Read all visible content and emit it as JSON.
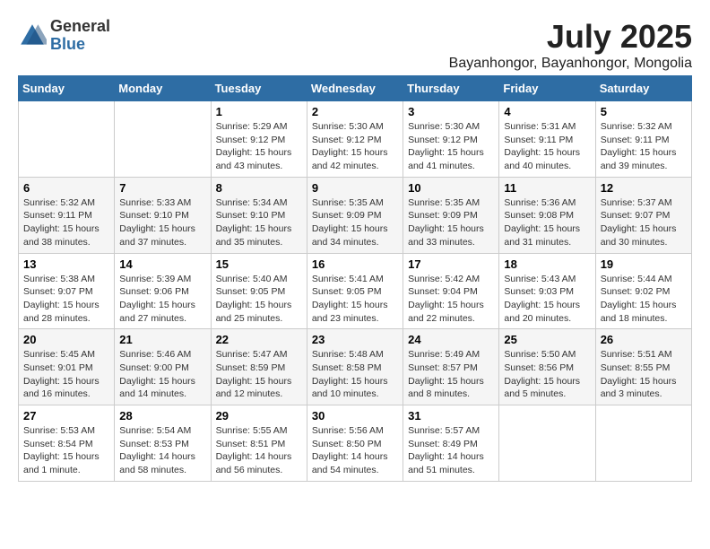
{
  "header": {
    "logo_general": "General",
    "logo_blue": "Blue",
    "month": "July 2025",
    "location": "Bayanhongor, Bayanhongor, Mongolia"
  },
  "calendar": {
    "days_of_week": [
      "Sunday",
      "Monday",
      "Tuesday",
      "Wednesday",
      "Thursday",
      "Friday",
      "Saturday"
    ],
    "weeks": [
      [
        {
          "day": "",
          "sunrise": "",
          "sunset": "",
          "daylight": ""
        },
        {
          "day": "",
          "sunrise": "",
          "sunset": "",
          "daylight": ""
        },
        {
          "day": "1",
          "sunrise": "Sunrise: 5:29 AM",
          "sunset": "Sunset: 9:12 PM",
          "daylight": "Daylight: 15 hours and 43 minutes."
        },
        {
          "day": "2",
          "sunrise": "Sunrise: 5:30 AM",
          "sunset": "Sunset: 9:12 PM",
          "daylight": "Daylight: 15 hours and 42 minutes."
        },
        {
          "day": "3",
          "sunrise": "Sunrise: 5:30 AM",
          "sunset": "Sunset: 9:12 PM",
          "daylight": "Daylight: 15 hours and 41 minutes."
        },
        {
          "day": "4",
          "sunrise": "Sunrise: 5:31 AM",
          "sunset": "Sunset: 9:11 PM",
          "daylight": "Daylight: 15 hours and 40 minutes."
        },
        {
          "day": "5",
          "sunrise": "Sunrise: 5:32 AM",
          "sunset": "Sunset: 9:11 PM",
          "daylight": "Daylight: 15 hours and 39 minutes."
        }
      ],
      [
        {
          "day": "6",
          "sunrise": "Sunrise: 5:32 AM",
          "sunset": "Sunset: 9:11 PM",
          "daylight": "Daylight: 15 hours and 38 minutes."
        },
        {
          "day": "7",
          "sunrise": "Sunrise: 5:33 AM",
          "sunset": "Sunset: 9:10 PM",
          "daylight": "Daylight: 15 hours and 37 minutes."
        },
        {
          "day": "8",
          "sunrise": "Sunrise: 5:34 AM",
          "sunset": "Sunset: 9:10 PM",
          "daylight": "Daylight: 15 hours and 35 minutes."
        },
        {
          "day": "9",
          "sunrise": "Sunrise: 5:35 AM",
          "sunset": "Sunset: 9:09 PM",
          "daylight": "Daylight: 15 hours and 34 minutes."
        },
        {
          "day": "10",
          "sunrise": "Sunrise: 5:35 AM",
          "sunset": "Sunset: 9:09 PM",
          "daylight": "Daylight: 15 hours and 33 minutes."
        },
        {
          "day": "11",
          "sunrise": "Sunrise: 5:36 AM",
          "sunset": "Sunset: 9:08 PM",
          "daylight": "Daylight: 15 hours and 31 minutes."
        },
        {
          "day": "12",
          "sunrise": "Sunrise: 5:37 AM",
          "sunset": "Sunset: 9:07 PM",
          "daylight": "Daylight: 15 hours and 30 minutes."
        }
      ],
      [
        {
          "day": "13",
          "sunrise": "Sunrise: 5:38 AM",
          "sunset": "Sunset: 9:07 PM",
          "daylight": "Daylight: 15 hours and 28 minutes."
        },
        {
          "day": "14",
          "sunrise": "Sunrise: 5:39 AM",
          "sunset": "Sunset: 9:06 PM",
          "daylight": "Daylight: 15 hours and 27 minutes."
        },
        {
          "day": "15",
          "sunrise": "Sunrise: 5:40 AM",
          "sunset": "Sunset: 9:05 PM",
          "daylight": "Daylight: 15 hours and 25 minutes."
        },
        {
          "day": "16",
          "sunrise": "Sunrise: 5:41 AM",
          "sunset": "Sunset: 9:05 PM",
          "daylight": "Daylight: 15 hours and 23 minutes."
        },
        {
          "day": "17",
          "sunrise": "Sunrise: 5:42 AM",
          "sunset": "Sunset: 9:04 PM",
          "daylight": "Daylight: 15 hours and 22 minutes."
        },
        {
          "day": "18",
          "sunrise": "Sunrise: 5:43 AM",
          "sunset": "Sunset: 9:03 PM",
          "daylight": "Daylight: 15 hours and 20 minutes."
        },
        {
          "day": "19",
          "sunrise": "Sunrise: 5:44 AM",
          "sunset": "Sunset: 9:02 PM",
          "daylight": "Daylight: 15 hours and 18 minutes."
        }
      ],
      [
        {
          "day": "20",
          "sunrise": "Sunrise: 5:45 AM",
          "sunset": "Sunset: 9:01 PM",
          "daylight": "Daylight: 15 hours and 16 minutes."
        },
        {
          "day": "21",
          "sunrise": "Sunrise: 5:46 AM",
          "sunset": "Sunset: 9:00 PM",
          "daylight": "Daylight: 15 hours and 14 minutes."
        },
        {
          "day": "22",
          "sunrise": "Sunrise: 5:47 AM",
          "sunset": "Sunset: 8:59 PM",
          "daylight": "Daylight: 15 hours and 12 minutes."
        },
        {
          "day": "23",
          "sunrise": "Sunrise: 5:48 AM",
          "sunset": "Sunset: 8:58 PM",
          "daylight": "Daylight: 15 hours and 10 minutes."
        },
        {
          "day": "24",
          "sunrise": "Sunrise: 5:49 AM",
          "sunset": "Sunset: 8:57 PM",
          "daylight": "Daylight: 15 hours and 8 minutes."
        },
        {
          "day": "25",
          "sunrise": "Sunrise: 5:50 AM",
          "sunset": "Sunset: 8:56 PM",
          "daylight": "Daylight: 15 hours and 5 minutes."
        },
        {
          "day": "26",
          "sunrise": "Sunrise: 5:51 AM",
          "sunset": "Sunset: 8:55 PM",
          "daylight": "Daylight: 15 hours and 3 minutes."
        }
      ],
      [
        {
          "day": "27",
          "sunrise": "Sunrise: 5:53 AM",
          "sunset": "Sunset: 8:54 PM",
          "daylight": "Daylight: 15 hours and 1 minute."
        },
        {
          "day": "28",
          "sunrise": "Sunrise: 5:54 AM",
          "sunset": "Sunset: 8:53 PM",
          "daylight": "Daylight: 14 hours and 58 minutes."
        },
        {
          "day": "29",
          "sunrise": "Sunrise: 5:55 AM",
          "sunset": "Sunset: 8:51 PM",
          "daylight": "Daylight: 14 hours and 56 minutes."
        },
        {
          "day": "30",
          "sunrise": "Sunrise: 5:56 AM",
          "sunset": "Sunset: 8:50 PM",
          "daylight": "Daylight: 14 hours and 54 minutes."
        },
        {
          "day": "31",
          "sunrise": "Sunrise: 5:57 AM",
          "sunset": "Sunset: 8:49 PM",
          "daylight": "Daylight: 14 hours and 51 minutes."
        },
        {
          "day": "",
          "sunrise": "",
          "sunset": "",
          "daylight": ""
        },
        {
          "day": "",
          "sunrise": "",
          "sunset": "",
          "daylight": ""
        }
      ]
    ]
  }
}
